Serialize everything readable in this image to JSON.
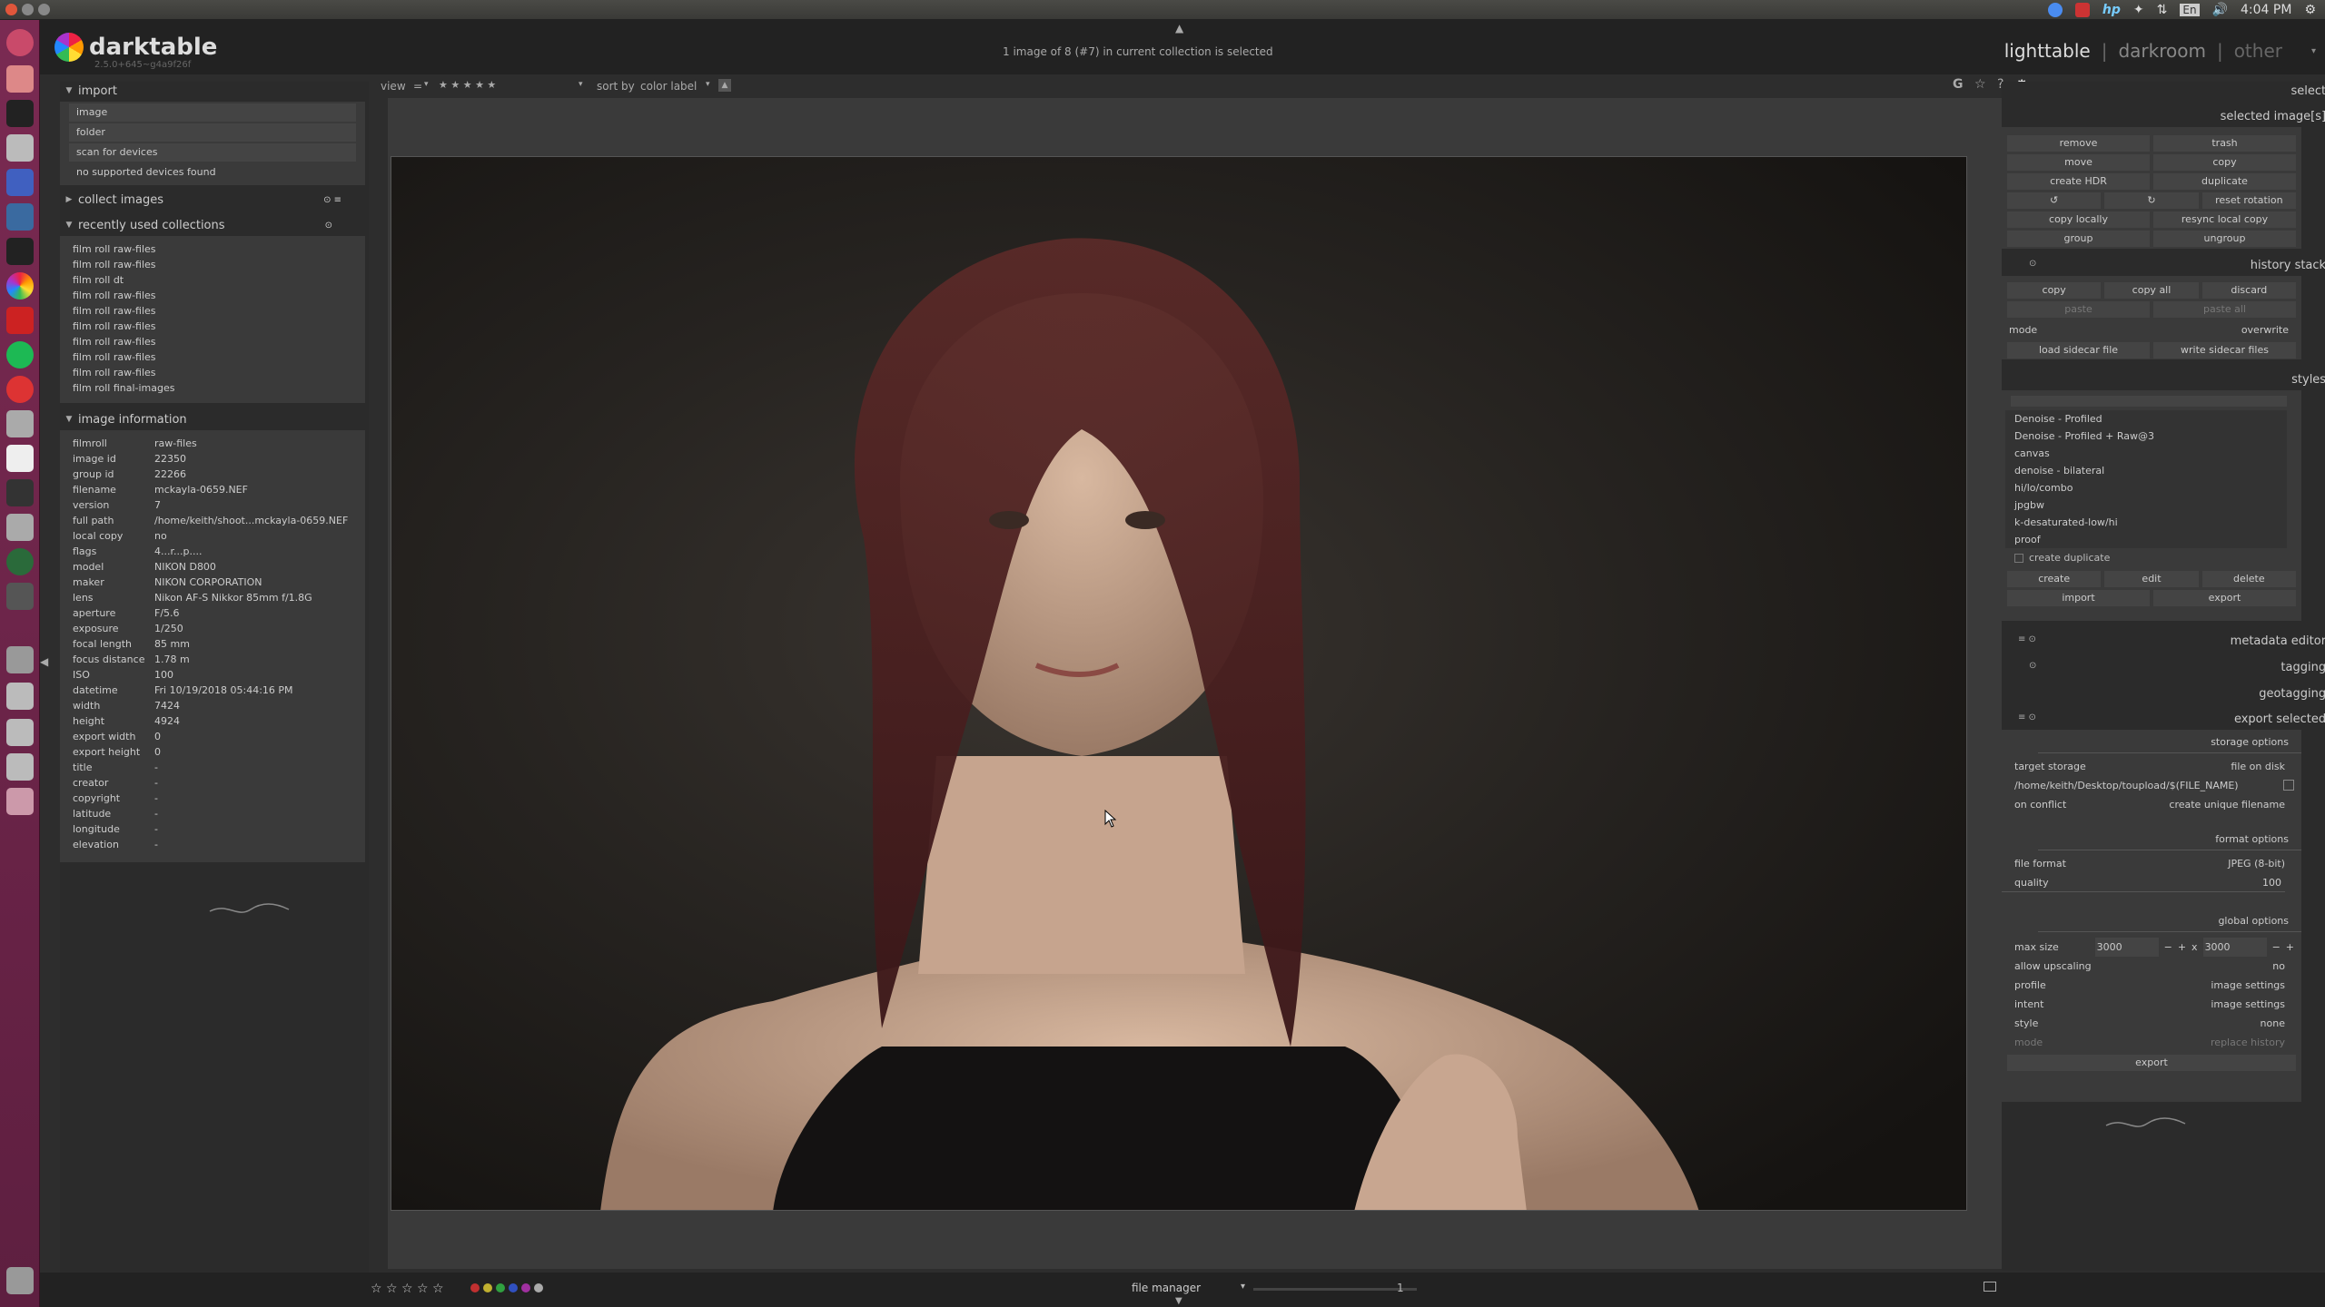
{
  "system": {
    "clock": "4:04 PM",
    "keyboard": "En"
  },
  "app": {
    "name": "darktable",
    "version": "2.5.0+645~g4a9f26f",
    "status_message": "1 image of 8 (#7) in current collection is selected",
    "views": {
      "lighttable": "lighttable",
      "darkroom": "darkroom",
      "other": "other",
      "sep": "|"
    }
  },
  "toolbar": {
    "view_label": "view",
    "view_op": "=",
    "view_rating": "★ ★ ★ ★ ★",
    "sort_label": "sort by",
    "sort_value": "color label"
  },
  "left": {
    "import": {
      "title": "import",
      "buttons": [
        "image",
        "folder",
        "scan for devices",
        "no supported devices found"
      ]
    },
    "collect": {
      "title": "collect images"
    },
    "recent": {
      "title": "recently used collections",
      "items": [
        "film roll raw-files",
        "film roll raw-files",
        "film roll dt",
        "film roll raw-files",
        "film roll raw-files",
        "film roll raw-files",
        "film roll raw-files",
        "film roll raw-files",
        "film roll raw-files",
        "film roll final-images"
      ]
    },
    "info": {
      "title": "image information",
      "rows": [
        {
          "k": "filmroll",
          "v": "raw-files"
        },
        {
          "k": "image id",
          "v": "22350"
        },
        {
          "k": "group id",
          "v": "22266"
        },
        {
          "k": "filename",
          "v": "mckayla-0659.NEF"
        },
        {
          "k": "version",
          "v": "7"
        },
        {
          "k": "full path",
          "v": "/home/keith/shoot...mckayla-0659.NEF"
        },
        {
          "k": "local copy",
          "v": "no"
        },
        {
          "k": "flags",
          "v": "4...r...p...."
        },
        {
          "k": "model",
          "v": "NIKON D800"
        },
        {
          "k": "maker",
          "v": "NIKON CORPORATION"
        },
        {
          "k": "lens",
          "v": "Nikon AF-S Nikkor 85mm f/1.8G"
        },
        {
          "k": "aperture",
          "v": "F/5.6"
        },
        {
          "k": "exposure",
          "v": "1/250"
        },
        {
          "k": "focal length",
          "v": "85 mm"
        },
        {
          "k": "focus distance",
          "v": "1.78 m"
        },
        {
          "k": "ISO",
          "v": "100"
        },
        {
          "k": "datetime",
          "v": "Fri 10/19/2018 05:44:16 PM"
        },
        {
          "k": "width",
          "v": "7424"
        },
        {
          "k": "height",
          "v": "4924"
        },
        {
          "k": "export width",
          "v": "0"
        },
        {
          "k": "export height",
          "v": "0"
        },
        {
          "k": "title",
          "v": "-"
        },
        {
          "k": "creator",
          "v": "-"
        },
        {
          "k": "copyright",
          "v": "-"
        },
        {
          "k": "latitude",
          "v": "-"
        },
        {
          "k": "longitude",
          "v": "-"
        },
        {
          "k": "elevation",
          "v": "-"
        }
      ]
    }
  },
  "right": {
    "select": "select",
    "selected_images": {
      "title": "selected image[s]",
      "rows": [
        [
          "remove",
          "trash"
        ],
        [
          "move",
          "copy"
        ],
        [
          "create HDR",
          "duplicate"
        ],
        [
          "",
          "reset rotation"
        ],
        [
          "copy locally",
          "resync local copy"
        ],
        [
          "group",
          "ungroup"
        ]
      ]
    },
    "history": {
      "title": "history stack",
      "row1": [
        "copy",
        "copy all",
        "discard"
      ],
      "row2": [
        "paste",
        "paste all"
      ],
      "mode_label": "mode",
      "mode_value": "overwrite",
      "row3": [
        "load sidecar file",
        "write sidecar files"
      ]
    },
    "styles": {
      "title": "styles",
      "items": [
        "Denoise - Profiled",
        "Denoise - Profiled + Raw@3",
        "canvas",
        "denoise - bilateral",
        "hi/lo/combo",
        "jpgbw",
        "k-desaturated-low/hi",
        "proof"
      ],
      "create_duplicate": "create duplicate",
      "row1": [
        "create",
        "edit",
        "delete"
      ],
      "row2": [
        "import",
        "export"
      ]
    },
    "metadata": "metadata editor",
    "tagging": "tagging",
    "geotagging": "geotagging",
    "export": {
      "title": "export selected",
      "storage_options": "storage options",
      "target_storage_label": "target storage",
      "target_storage_value": "file on disk",
      "path": "/home/keith/Desktop/toupload/$(FILE_NAME)",
      "conflict_label": "on conflict",
      "conflict_value": "create unique filename",
      "format_options": "format options",
      "file_format_label": "file format",
      "file_format_value": "JPEG (8-bit)",
      "quality_label": "quality",
      "quality_value": "100",
      "global_options": "global options",
      "max_size_label": "max size",
      "max_w": "3000",
      "max_x": "x",
      "max_h": "3000",
      "upscaling_label": "allow upscaling",
      "upscaling_value": "no",
      "profile_label": "profile",
      "profile_value": "image settings",
      "intent_label": "intent",
      "intent_value": "image settings",
      "style_label": "style",
      "style_value": "none",
      "mode_label": "mode",
      "mode_value": "replace history",
      "export_button": "export"
    }
  },
  "bottom": {
    "stars": "☆ ☆ ☆ ☆ ☆",
    "layout": "file manager",
    "zoom": "1",
    "color_labels": [
      "#c03030",
      "#c0b030",
      "#30a040",
      "#3050c0",
      "#a030a0",
      "#aaaaaa"
    ]
  }
}
